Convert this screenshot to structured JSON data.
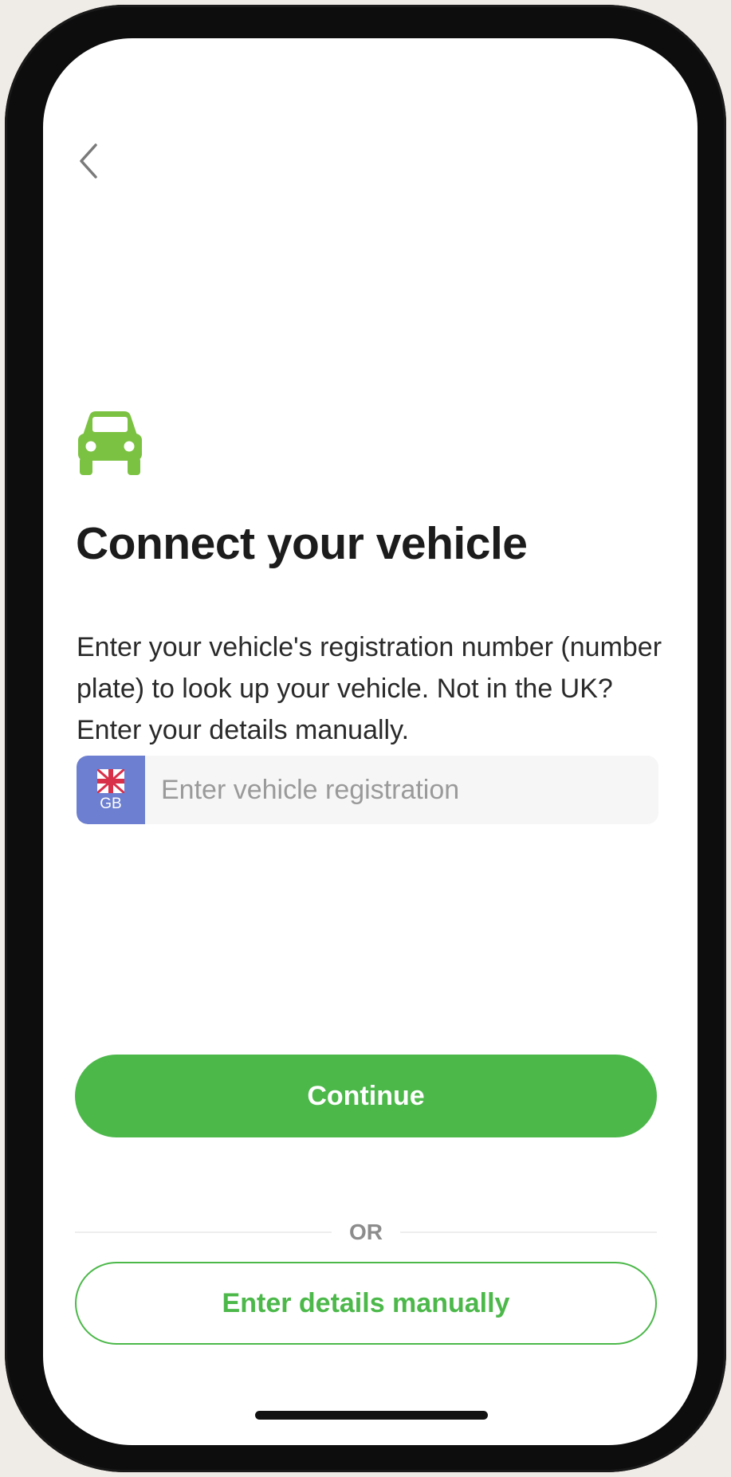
{
  "header": {
    "back_icon": "chevron-left-icon"
  },
  "hero": {
    "icon": "car-icon",
    "title": "Connect your vehicle",
    "description": "Enter your vehicle's registration number (number plate) to look up your vehicle. Not in the UK? Enter your details manually."
  },
  "registration": {
    "country_flag_icon": "uk-flag-icon",
    "country_code": "GB",
    "value": "",
    "placeholder": "Enter vehicle registration"
  },
  "actions": {
    "continue_label": "Continue",
    "divider_label": "OR",
    "manual_label": "Enter details manually"
  },
  "colors": {
    "accent": "#4cb84a",
    "car_icon": "#7cc242",
    "gb_badge": "#6d7fd0",
    "input_background": "#f6f6f6",
    "title_text": "#1c1c1c",
    "placeholder_text": "#9a9a9a"
  }
}
